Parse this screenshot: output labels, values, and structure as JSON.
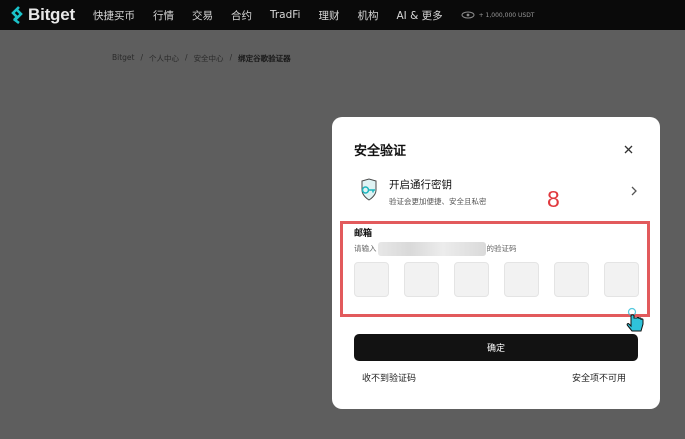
{
  "nav": {
    "logo": "Bitget",
    "items": [
      "快捷买币",
      "行情",
      "交易",
      "合约",
      "TradFi",
      "理财",
      "机构",
      "AI & 更多"
    ],
    "promo": "+ 1,000,000 USDT"
  },
  "breadcrumb": {
    "items": [
      "Bitget",
      "个人中心",
      "安全中心"
    ],
    "current": "绑定谷歌验证器",
    "separator": "/"
  },
  "modal": {
    "title": "安全验证",
    "passkey": {
      "title": "开启通行密钥",
      "subtitle": "验证会更加便捷、安全且私密"
    },
    "step_number": "8",
    "email": {
      "label": "邮箱",
      "hint_prefix": "请输入",
      "hint_suffix": "的验证码",
      "code_box_count": 6
    },
    "confirm_label": "确定",
    "no_code_label": "收不到验证码",
    "unavailable_label": "安全项不可用"
  },
  "colors": {
    "highlight": "#e25a5c",
    "step_number": "#e0393e",
    "button": "#121212"
  }
}
